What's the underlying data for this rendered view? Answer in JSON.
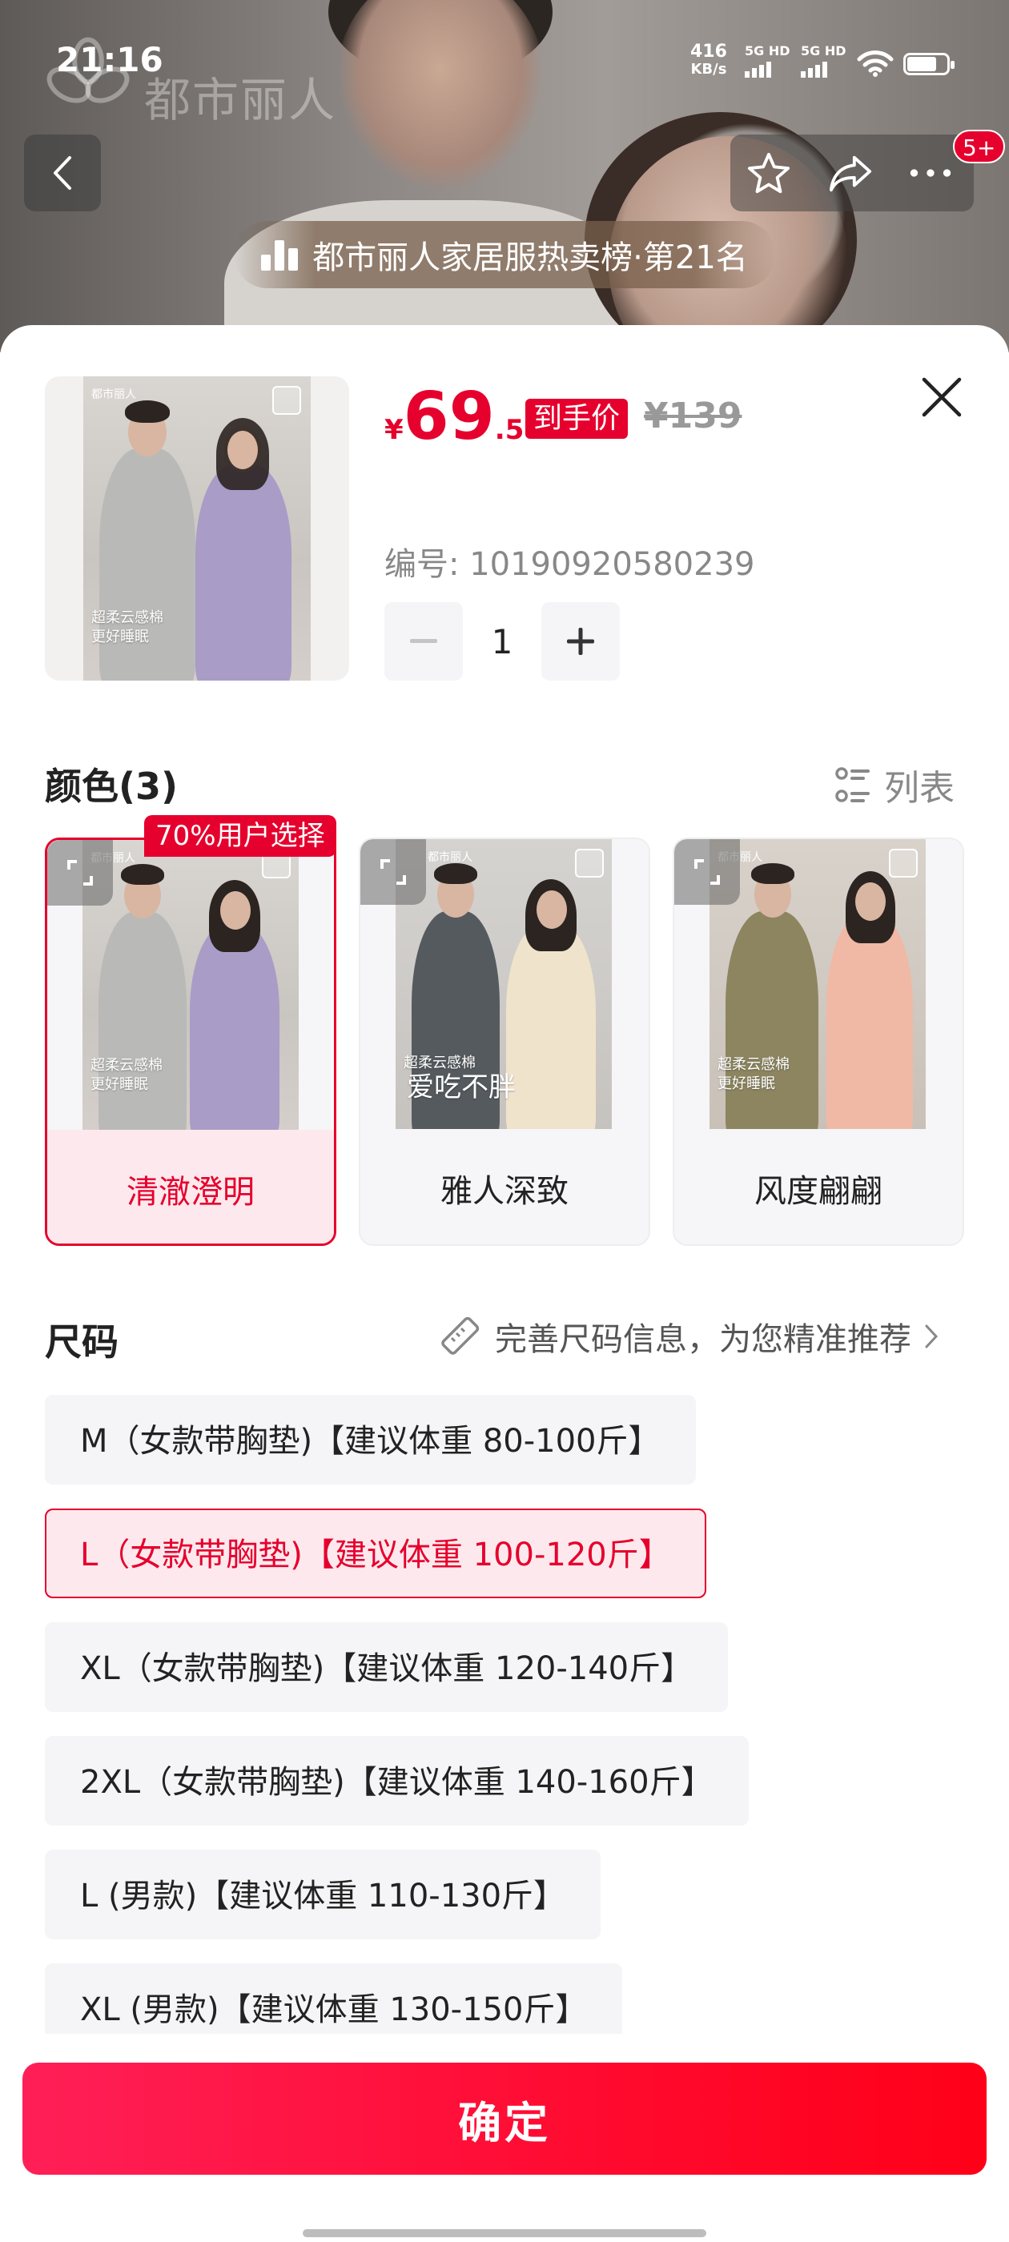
{
  "status_bar": {
    "time": "21:16",
    "net_speed_value": "416",
    "net_speed_unit": "KB/s",
    "sim1": "5G HD",
    "sim2": "5G HD"
  },
  "hero": {
    "watermark": "都市丽人",
    "badge_count": "5+",
    "rank_banner": "都市丽人家居服热卖榜·第21名"
  },
  "product": {
    "price_symbol": "¥",
    "price_integer": "69",
    "price_decimal": ".5",
    "deal_tag": "到手价",
    "original_price": "¥139",
    "sku_number": "编号: 10190920580239",
    "quantity": "1",
    "thumb_brand": "都市丽人",
    "thumb_caption_1": "超柔云感棉",
    "thumb_caption_2": "更好睡眠"
  },
  "color_section": {
    "title": "颜色(3)",
    "list_toggle": "列表",
    "popular_tag": "70%用户选择",
    "options": [
      {
        "label": "清澈澄明",
        "selected": true,
        "caption_1": "超柔云感棉",
        "caption_2": "更好睡眠",
        "brand": "都市丽人"
      },
      {
        "label": "雅人深致",
        "selected": false,
        "caption_1": "超柔云感棉",
        "caption_2": "爱吃不胖",
        "brand": "都市丽人"
      },
      {
        "label": "风度翩翩",
        "selected": false,
        "caption_1": "超柔云感棉",
        "caption_2": "更好睡眠",
        "brand": "都市丽人"
      }
    ]
  },
  "size_section": {
    "title": "尺码",
    "size_link": "完善尺码信息，为您精准推荐",
    "options": [
      {
        "label": "M（女款带胸垫)【建议体重 80-100斤】",
        "selected": false
      },
      {
        "label": "L（女款带胸垫)【建议体重 100-120斤】",
        "selected": true
      },
      {
        "label": "XL（女款带胸垫)【建议体重 120-140斤】",
        "selected": false
      },
      {
        "label": "2XL（女款带胸垫)【建议体重 140-160斤】",
        "selected": false
      },
      {
        "label": "L (男款)【建议体重 110-130斤】",
        "selected": false
      },
      {
        "label": "XL (男款)【建议体重 130-150斤】",
        "selected": false
      }
    ]
  },
  "footer": {
    "confirm_label": "确定"
  },
  "colors": {
    "accent": "#e6002d",
    "selected_bg": "#fde9ed",
    "option_bg": "#f5f5f7"
  }
}
